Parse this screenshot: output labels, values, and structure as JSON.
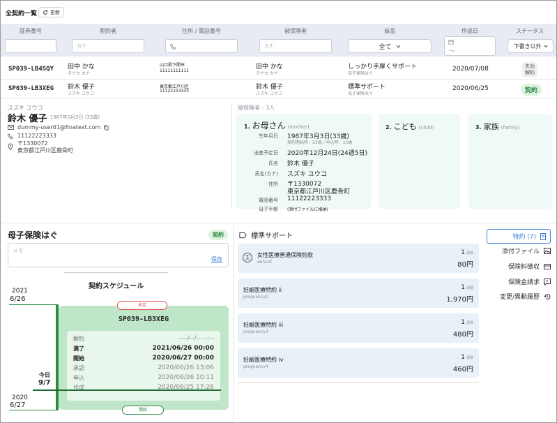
{
  "page_title": "全契約一覧",
  "refresh_label": "更新",
  "columns": [
    "証券番号",
    "契約者",
    "住所 / 電話番号",
    "被保険者",
    "商品",
    "作成日",
    "ステータス"
  ],
  "filters": {
    "contractor_placeholder": "カナ",
    "insured_placeholder": "カナ",
    "product_value": "全て",
    "status_value": "下書き以外",
    "date_sep": "〜"
  },
  "rows": [
    {
      "policy": "SP039-LB4SQY",
      "contractor": "田中 かな",
      "contractor_kana": "タナカ カナ",
      "address": "山口県下関市",
      "phone": "11111111111",
      "insured": "田中 かな",
      "insured_kana": "タナカ カナ",
      "product": "しっかり手厚くサポート",
      "product_sub": "母子保険はぐ",
      "date": "2020/07/08",
      "status": "失効\n解約"
    },
    {
      "policy": "SP039-LB3XEG",
      "contractor": "鈴木 優子",
      "contractor_kana": "スズキ ユウコ",
      "address": "東京都江戸川区",
      "phone": "11122223333",
      "insured": "鈴木 優子",
      "insured_kana": "スズキ ユウコ",
      "product": "標準サポート",
      "product_sub": "母子保険はぐ",
      "date": "2020/06/25",
      "status": "契約"
    }
  ],
  "contractor": {
    "kana": "スズキ ユウコ",
    "name": "鈴木 優子",
    "birth": "- 1987年3月3日 (33歳)",
    "email": "dummy-user01@finatext.com",
    "phone": "11122223333",
    "postal": "〒1330072",
    "address": "東京都江戸川区鹿骨町"
  },
  "insured_header": "被保険者 - 3人",
  "insured": [
    {
      "num": "1.",
      "name": "お母さん",
      "role": "(mother)"
    },
    {
      "num": "2.",
      "name": "こども",
      "role": "(child)"
    },
    {
      "num": "3.",
      "name": "家族",
      "role": "(family)"
    }
  ],
  "mother_details": [
    {
      "label": "生年月日",
      "value": "1987年3月3日(33歳)",
      "sub": "契約開始時：33歳 / 申込時：33歳"
    },
    {
      "label": "出産予定日",
      "value": "2020年12月24日(24週5日)"
    },
    {
      "label": "氏名",
      "value": "鈴木 優子"
    },
    {
      "label": "氏名(カナ)",
      "value": "スズキ ユウコ"
    },
    {
      "label": "住所",
      "value": "〒1330072",
      "value2": "東京都江戸川区鹿骨町"
    },
    {
      "label": "電話番号",
      "value": "11122223333"
    },
    {
      "label": "母子手帳",
      "value": "(添付ファイルに格納)"
    }
  ],
  "policy_panel": {
    "title": "母子保険はぐ",
    "status": "契約",
    "memo_placeholder": "メモ",
    "save_label": "保存",
    "schedule_title": "契約スケジュール",
    "year_top": "2021",
    "date_top": "6/26",
    "today_label": "今日",
    "today_date": "9/7",
    "year_bottom": "2020",
    "date_bottom": "6/27",
    "pill_top": "未定",
    "pill_bottom": "開始",
    "policy_no": "SP039-LB3XEG",
    "schedule": [
      {
        "label": "解約",
        "value": "----/--/-- --:--",
        "style": "muted"
      },
      {
        "label": "満了",
        "value": "2021/06/26 00:00",
        "style": "bold"
      },
      {
        "label": "開始",
        "value": "2020/06/27 00:00",
        "style": "bold"
      },
      {
        "label": "承認",
        "value": "2020/06/26 13:06",
        "style": "muted"
      },
      {
        "label": "申込",
        "value": "2020/06/26 10:11",
        "style": "muted"
      },
      {
        "label": "作成",
        "value": "2020/06/25 17:26",
        "style": "muted"
      }
    ]
  },
  "plan": {
    "title": "標準サポート",
    "items": [
      {
        "name": "女性医療普通保険約款",
        "code": "default",
        "count": "1",
        "unit": "保険",
        "price": "80円",
        "main": true
      },
      {
        "name": "妊娠医療特約 ii",
        "code": "pregnancy2",
        "count": "1",
        "unit": "保険",
        "price": "1,970円"
      },
      {
        "name": "妊娠医療特約 iii",
        "code": "pregnancy3",
        "count": "1",
        "unit": "保険",
        "price": "480円"
      },
      {
        "name": "妊娠医療特約 iv",
        "code": "pregnancy4",
        "count": "1",
        "unit": "保険",
        "price": "460円"
      }
    ]
  },
  "side_menu": {
    "rider_label": "特約 (7)",
    "items": [
      "添付ファイル",
      "保険料徴収",
      "保険金請求",
      "変更/異動履歴"
    ]
  },
  "colors": {
    "accent": "#3b7dd8",
    "green": "#2e8b43",
    "band": "#e8ebf3"
  }
}
